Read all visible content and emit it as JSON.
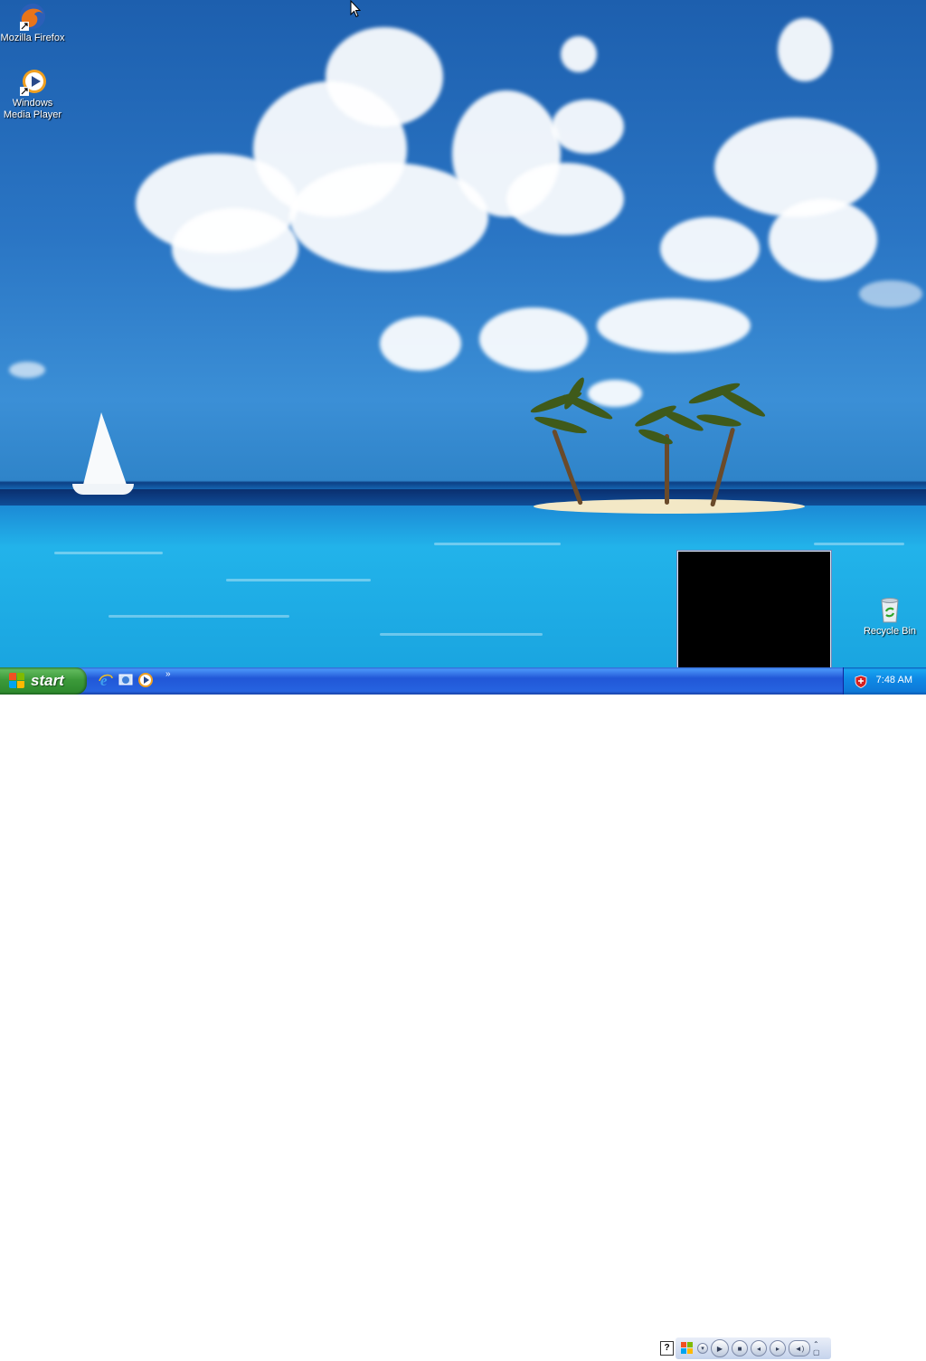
{
  "desktop": {
    "icons": [
      {
        "label": "Mozilla Firefox",
        "icon": "firefox-icon"
      },
      {
        "label": "Windows Media Player",
        "icon": "media-player-icon"
      },
      {
        "label": "Recycle Bin",
        "icon": "recycle-bin-icon"
      }
    ]
  },
  "taskbar": {
    "start_label": "start",
    "quick_launch": [
      {
        "icon": "internet-explorer-icon"
      },
      {
        "icon": "show-desktop-icon"
      },
      {
        "icon": "media-player-icon"
      }
    ],
    "quick_launch_more": "»",
    "help_label": "?",
    "tray": {
      "clock": "7:48 AM",
      "security_icon": "security-shield-icon"
    }
  },
  "colors": {
    "taskbar_blue": "#2457d6",
    "start_green": "#3c9a3a",
    "tray_blue": "#0f8ae6"
  }
}
